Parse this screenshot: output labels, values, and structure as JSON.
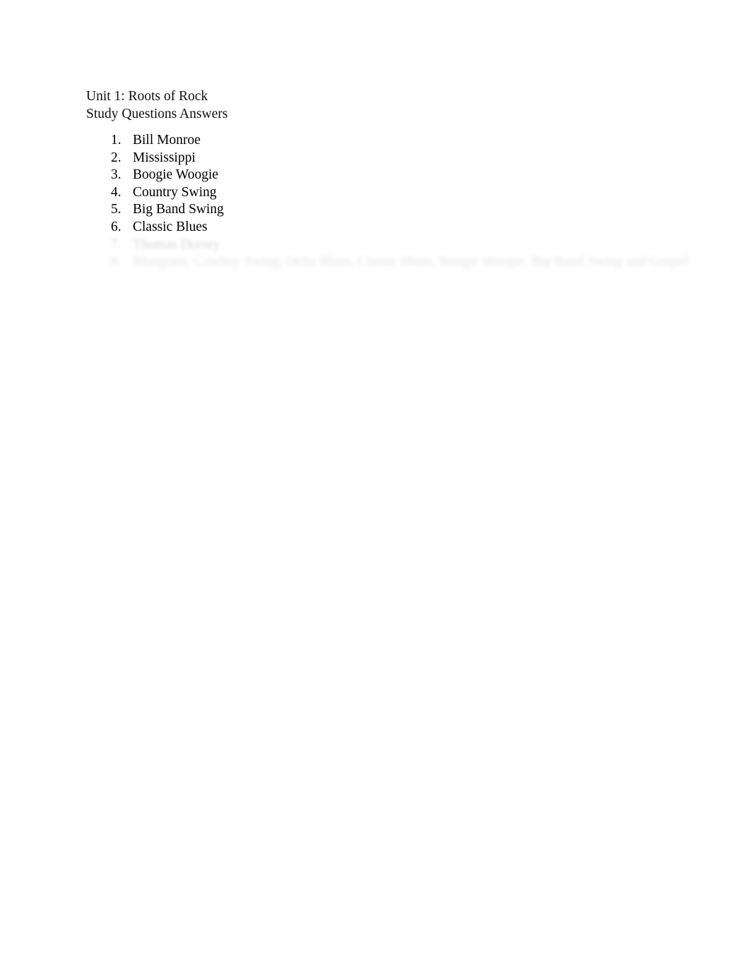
{
  "document": {
    "header": {
      "line1": "Unit 1: Roots of Rock",
      "line2": "Study Questions Answers"
    },
    "answers": [
      {
        "number": "1.",
        "text": "Bill Monroe",
        "legible": true
      },
      {
        "number": "2.",
        "text": "Mississippi",
        "legible": true
      },
      {
        "number": "3.",
        "text": "Boogie Woogie",
        "legible": true
      },
      {
        "number": "4.",
        "text": "Country Swing",
        "legible": true
      },
      {
        "number": "5.",
        "text": "Big Band Swing",
        "legible": true
      },
      {
        "number": "6.",
        "text": "Classic Blues",
        "legible": true
      },
      {
        "number": "7.",
        "text": "Thomas Dorsey",
        "legible": false
      },
      {
        "number": "8.",
        "text": "Bluegrass, Cowboy Swing, Delta Blues, Classic Blues, Boogie Woogie, Big Band Swing and Gospel",
        "legible": false
      }
    ]
  },
  "colors": {
    "page_background": "#ffffff",
    "text": "#000000",
    "faded_text": "#bdbdbd"
  }
}
